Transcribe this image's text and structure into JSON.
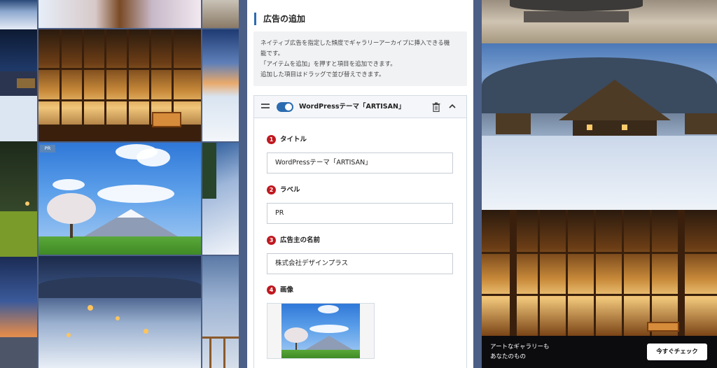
{
  "panel": {
    "section_title": "広告の追加",
    "description": [
      "ネイティブ広告を指定した頻度でギャラリーアーカイブに挿入できる機",
      "能です。",
      "「アイテムを追加」を押すと項目を追加できます。",
      "追加した項目はドラッグで並び替えできます。"
    ],
    "item": {
      "title": "WordPressテーマ「ARTISAN」",
      "enabled": true,
      "fields": [
        {
          "num": "1",
          "label": "タイトル",
          "value": "WordPressテーマ「ARTISAN」"
        },
        {
          "num": "2",
          "label": "ラベル",
          "value": "PR"
        },
        {
          "num": "3",
          "label": "広告主の名前",
          "value": "株式会社デザインプラス"
        },
        {
          "num": "4",
          "label": "画像"
        }
      ]
    },
    "icons": {
      "drag": "drag-handle-icon",
      "delete": "trash-icon",
      "collapse": "chevron-up-icon"
    }
  },
  "gallery": {
    "pr_badge": "PR"
  },
  "cta": {
    "text": "アートなギャラリーも\nあなたのもの",
    "button": "今すぐチェック"
  },
  "colors": {
    "accent": "#2b6cb0",
    "number_badge": "#c0181f",
    "cta_bar": "#0c0c0f"
  }
}
